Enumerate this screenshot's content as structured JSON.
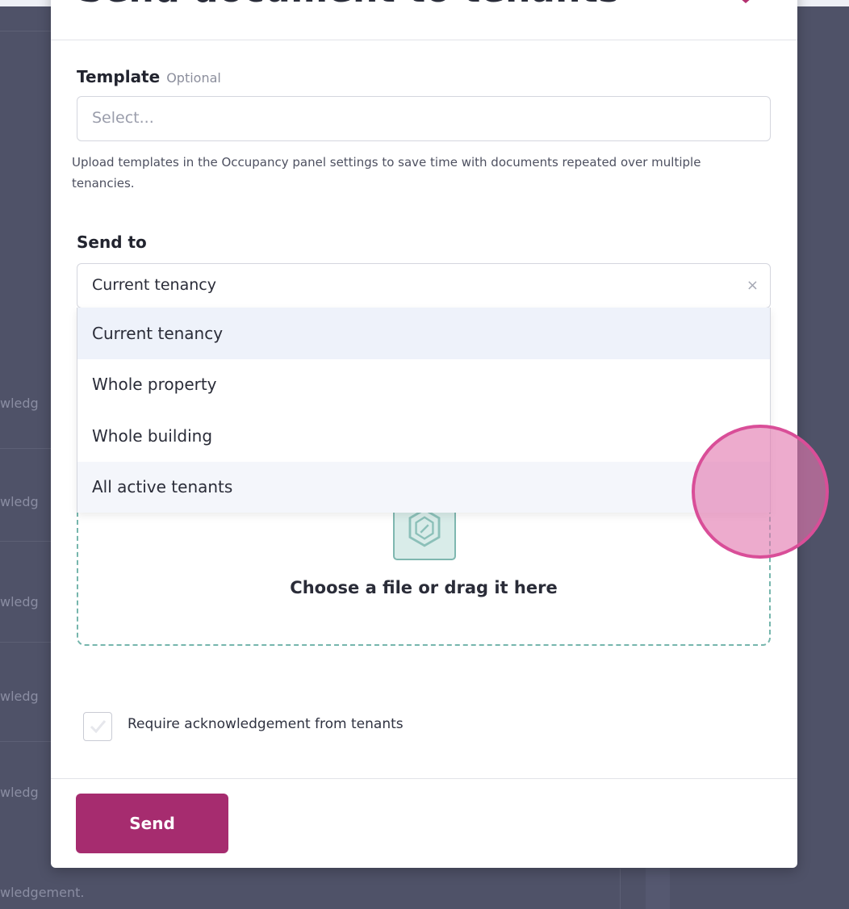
{
  "modal": {
    "title": "Send document to tenants",
    "template": {
      "label": "Template",
      "optional": "Optional",
      "placeholder": "Select...",
      "helper": "Upload templates in the Occupancy panel settings to save time with documents repeated over multiple tenancies."
    },
    "send_to": {
      "label": "Send to",
      "value": "Current tenancy",
      "clear_icon": "×",
      "options": [
        "Current tenancy",
        "Whole property",
        "Whole building",
        "All active tenants"
      ]
    },
    "upload": {
      "text": "Choose a file or drag it here",
      "icon": "file-upload-icon"
    },
    "acknowledgement": {
      "label": "Require acknowledgement from tenants",
      "checked": false
    },
    "send_label": "Send"
  },
  "background": {
    "row_text": [
      "wledg",
      "wledg",
      "wledg",
      "wledg",
      "wledg"
    ],
    "bottom_text": "wledgement."
  },
  "colors": {
    "accent": "#a62c6f",
    "dropzone_border": "#76b6ad",
    "overlay": "#4f5268",
    "cursor": "#d94e98"
  }
}
